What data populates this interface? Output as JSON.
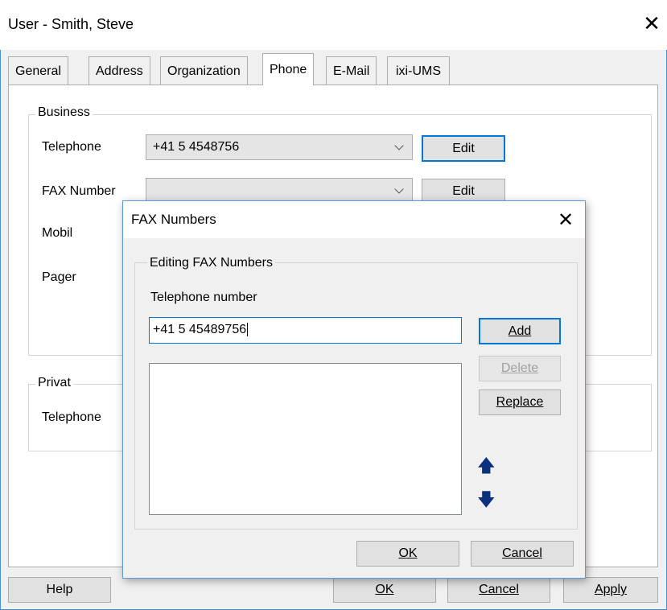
{
  "window": {
    "title": "User - Smith, Steve",
    "close_glyph": "✕"
  },
  "tabs": [
    {
      "label": "General"
    },
    {
      "label": "Address"
    },
    {
      "label": "Organization"
    },
    {
      "label": "Phone"
    },
    {
      "label": "E-Mail"
    },
    {
      "label": "ixi-UMS"
    }
  ],
  "active_tab": "Phone",
  "business": {
    "label": "Business",
    "telephone_label": "Telephone",
    "telephone_value": "+41 5 4548756",
    "telephone_edit": "Edit",
    "fax_label": "FAX Number",
    "fax_value": "",
    "fax_edit": "Edit",
    "mobil_label": "Mobil",
    "pager_label": "Pager"
  },
  "privat": {
    "label": "Privat",
    "telephone_label": "Telephone"
  },
  "footer": {
    "help": "Help",
    "ok": "OK",
    "cancel": "Cancel",
    "apply": "Apply"
  },
  "fax_dialog": {
    "title": "FAX Numbers",
    "close_glyph": "✕",
    "group_label": "Editing FAX Numbers",
    "field_label": "Telephone number",
    "field_value": "+41 5 45489756",
    "add": "Add",
    "delete": "Delete",
    "replace": "Replace",
    "ok": "OK",
    "cancel": "Cancel",
    "move_up_glyph": "🡅",
    "move_down_glyph": "🡇",
    "list_items": []
  },
  "colors": {
    "accent": "#0078d7",
    "arrow": "#0a2f7d",
    "window_border": "#4a90d9"
  }
}
